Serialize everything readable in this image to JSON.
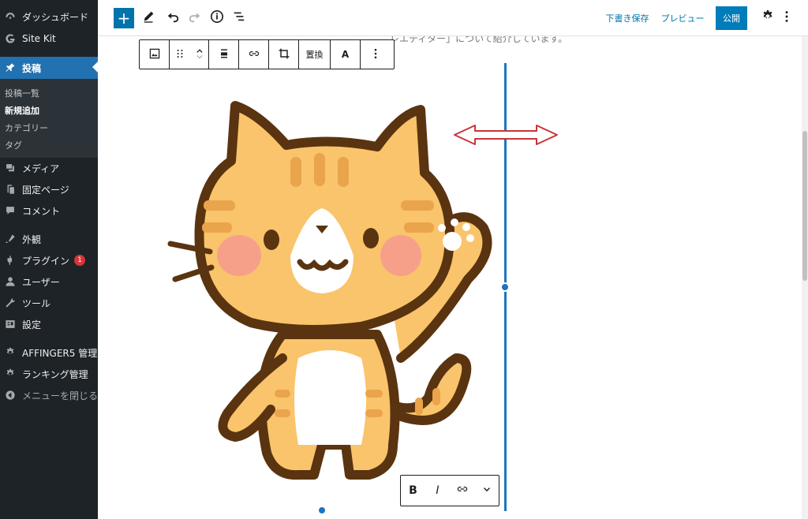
{
  "sidebar": {
    "items": [
      {
        "label": "ダッシュボード",
        "icon": "dashboard-icon"
      },
      {
        "label": "Site Kit",
        "icon": "site-kit-icon"
      },
      {
        "label": "投稿",
        "icon": "pin-icon"
      },
      {
        "label": "メディア",
        "icon": "media-icon"
      },
      {
        "label": "固定ページ",
        "icon": "page-icon"
      },
      {
        "label": "コメント",
        "icon": "comment-icon"
      },
      {
        "label": "外観",
        "icon": "appearance-icon"
      },
      {
        "label": "プラグイン",
        "icon": "plugin-icon",
        "badge": "1"
      },
      {
        "label": "ユーザー",
        "icon": "user-icon"
      },
      {
        "label": "ツール",
        "icon": "tool-icon"
      },
      {
        "label": "設定",
        "icon": "settings-icon"
      },
      {
        "label": "AFFINGER5 管理",
        "icon": "gear-icon"
      },
      {
        "label": "ランキング管理",
        "icon": "gear-icon"
      },
      {
        "label": "メニューを閉じる",
        "icon": "collapse-icon"
      }
    ],
    "submenu": [
      {
        "label": "投稿一覧"
      },
      {
        "label": "新規追加"
      },
      {
        "label": "カテゴリー"
      },
      {
        "label": "タグ"
      }
    ]
  },
  "topbar": {
    "add_label": "+",
    "save_draft": "下書き保存",
    "preview": "プレビュー",
    "publish": "公開"
  },
  "content": {
    "paragraph_snippet": "レエディター」について紹介しています。"
  },
  "block_toolbar": {
    "replace": "置換",
    "text_a": "A"
  },
  "caption_toolbar": {
    "bold": "B",
    "italic": "I"
  },
  "colors": {
    "sidebar_bg": "#1d2327",
    "accent": "#2271b1",
    "publish_bg": "#007cba",
    "cat_orange": "#f9c46b",
    "cat_outline": "#5a3410"
  }
}
